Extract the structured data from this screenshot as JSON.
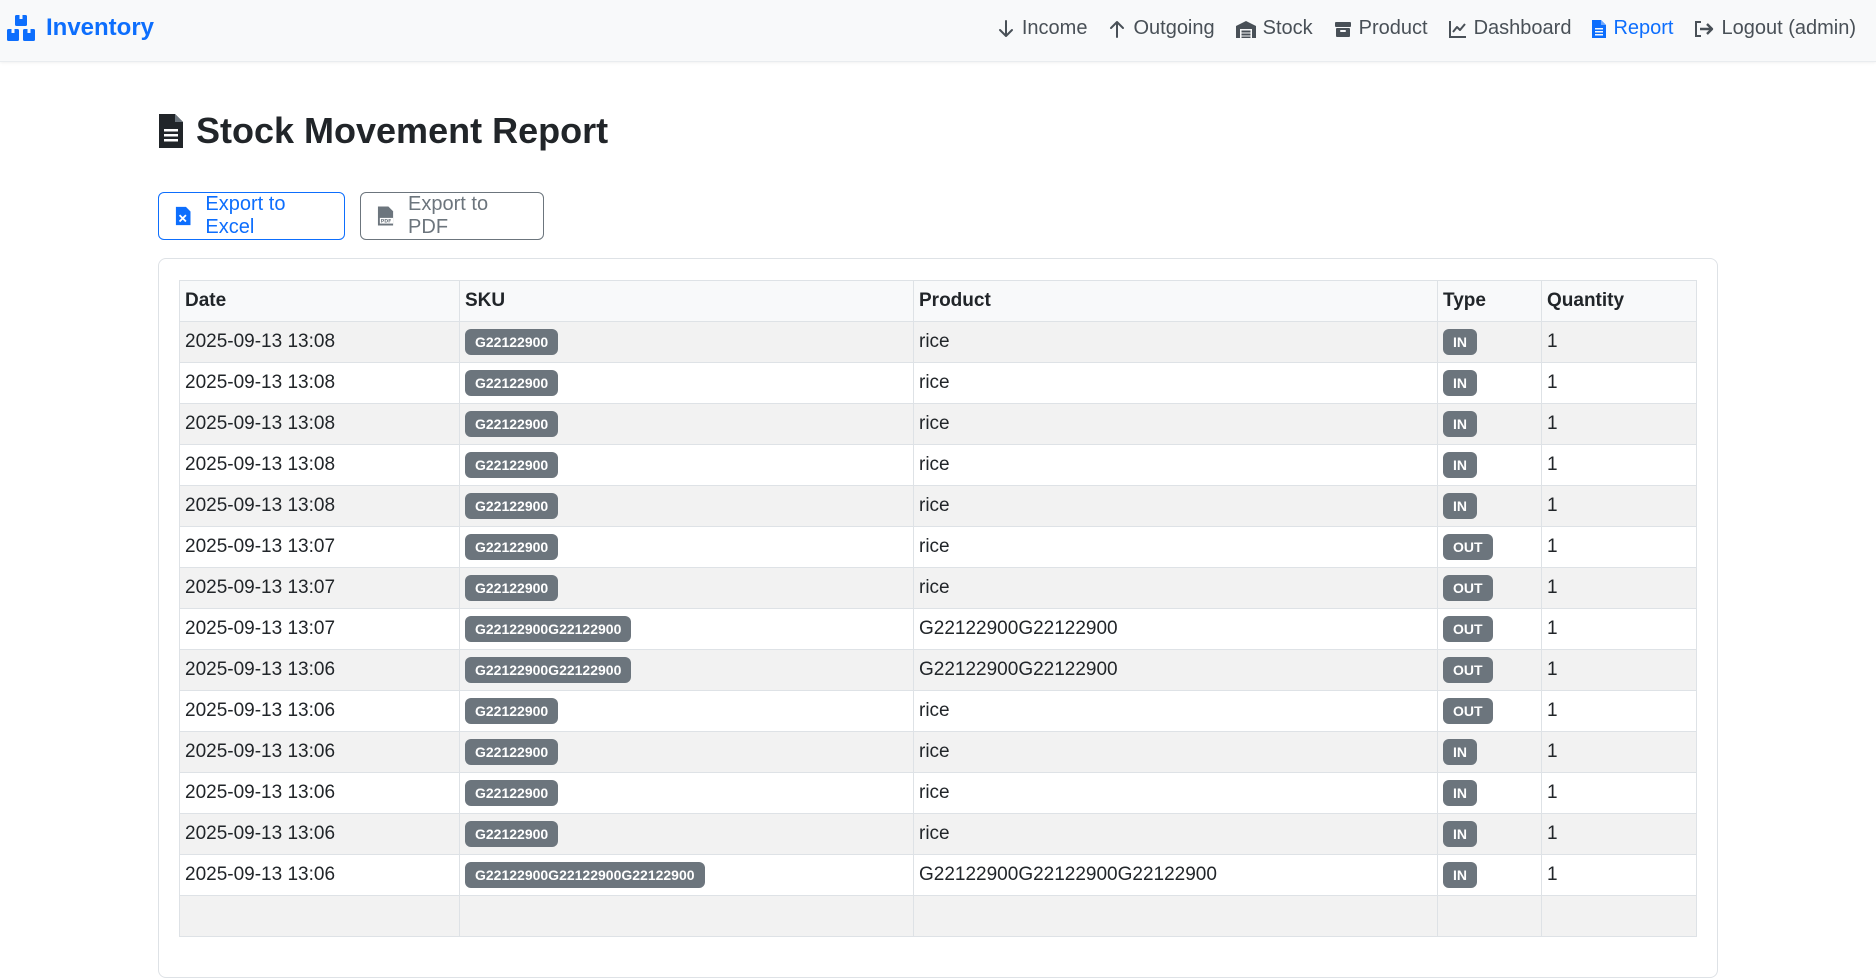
{
  "navbar": {
    "brand": "Inventory",
    "items": [
      {
        "label": "Income",
        "icon": "arrow-down-icon",
        "active": false
      },
      {
        "label": "Outgoing",
        "icon": "arrow-up-icon",
        "active": false
      },
      {
        "label": "Stock",
        "icon": "warehouse-icon",
        "active": false
      },
      {
        "label": "Product",
        "icon": "box-icon",
        "active": false
      },
      {
        "label": "Dashboard",
        "icon": "chart-line-icon",
        "active": false
      },
      {
        "label": "Report",
        "icon": "file-icon",
        "active": true
      },
      {
        "label": "Logout (admin)",
        "icon": "logout-icon",
        "active": false
      }
    ]
  },
  "page": {
    "title": "Stock Movement Report",
    "export_excel": "Export to Excel",
    "export_pdf": "Export to PDF"
  },
  "table": {
    "headers": [
      "Date",
      "SKU",
      "Product",
      "Type",
      "Quantity"
    ],
    "rows": [
      {
        "date": "2025-09-13 13:08",
        "sku": "G22122900",
        "product": "rice",
        "type": "IN",
        "quantity": "1"
      },
      {
        "date": "2025-09-13 13:08",
        "sku": "G22122900",
        "product": "rice",
        "type": "IN",
        "quantity": "1"
      },
      {
        "date": "2025-09-13 13:08",
        "sku": "G22122900",
        "product": "rice",
        "type": "IN",
        "quantity": "1"
      },
      {
        "date": "2025-09-13 13:08",
        "sku": "G22122900",
        "product": "rice",
        "type": "IN",
        "quantity": "1"
      },
      {
        "date": "2025-09-13 13:08",
        "sku": "G22122900",
        "product": "rice",
        "type": "IN",
        "quantity": "1"
      },
      {
        "date": "2025-09-13 13:07",
        "sku": "G22122900",
        "product": "rice",
        "type": "OUT",
        "quantity": "1"
      },
      {
        "date": "2025-09-13 13:07",
        "sku": "G22122900",
        "product": "rice",
        "type": "OUT",
        "quantity": "1"
      },
      {
        "date": "2025-09-13 13:07",
        "sku": "G22122900G22122900",
        "product": "G22122900G22122900",
        "type": "OUT",
        "quantity": "1"
      },
      {
        "date": "2025-09-13 13:06",
        "sku": "G22122900G22122900",
        "product": "G22122900G22122900",
        "type": "OUT",
        "quantity": "1"
      },
      {
        "date": "2025-09-13 13:06",
        "sku": "G22122900",
        "product": "rice",
        "type": "OUT",
        "quantity": "1"
      },
      {
        "date": "2025-09-13 13:06",
        "sku": "G22122900",
        "product": "rice",
        "type": "IN",
        "quantity": "1"
      },
      {
        "date": "2025-09-13 13:06",
        "sku": "G22122900",
        "product": "rice",
        "type": "IN",
        "quantity": "1"
      },
      {
        "date": "2025-09-13 13:06",
        "sku": "G22122900",
        "product": "rice",
        "type": "IN",
        "quantity": "1"
      },
      {
        "date": "2025-09-13 13:06",
        "sku": "G22122900G22122900G22122900",
        "product": "G22122900G22122900G22122900",
        "type": "IN",
        "quantity": "1"
      }
    ]
  },
  "colors": {
    "primary": "#0d6efd",
    "secondary": "#6c757d",
    "navbar_bg": "#f8f9fa",
    "stripe": "#f2f2f2"
  }
}
